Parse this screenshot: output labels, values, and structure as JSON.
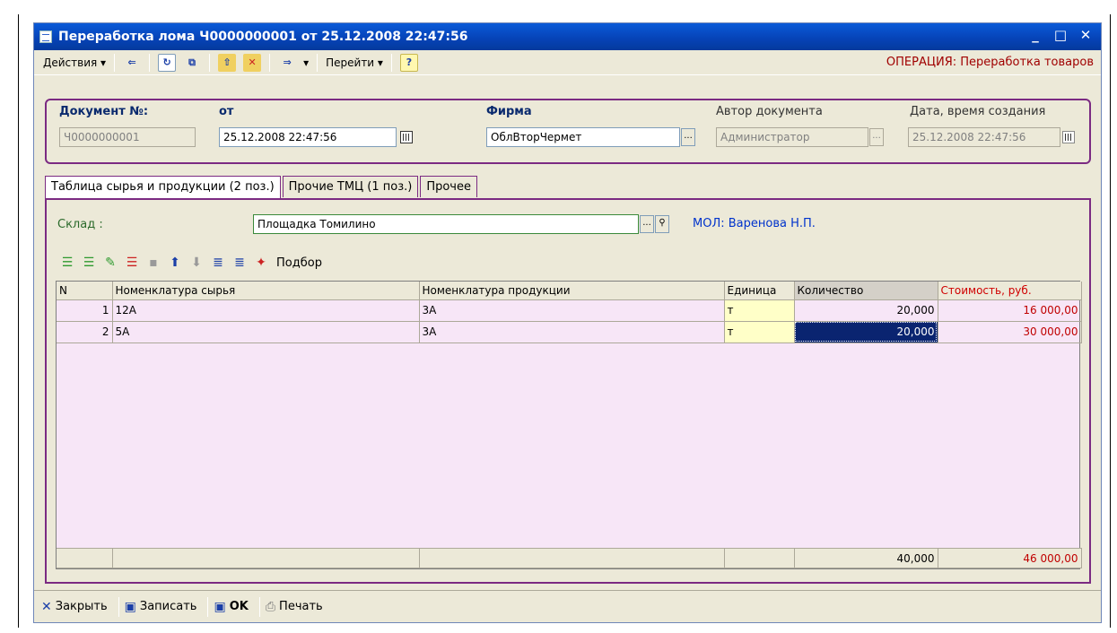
{
  "window": {
    "title": "Переработка лома Ч0000000001 от 25.12.2008 22:47:56",
    "controls": {
      "minimize": "_",
      "maximize": "□",
      "close": "✕"
    }
  },
  "toolbar": {
    "actions_label": "Действия ▾",
    "goto_label": "Перейти ▾",
    "help_label": "?",
    "operation_text": "ОПЕРАЦИЯ: Переработка товаров"
  },
  "header": {
    "doc_number_label": "Документ №:",
    "doc_number_value": "Ч0000000001",
    "date_label": "от",
    "date_value": "25.12.2008 22:47:56",
    "firm_label": "Фирма",
    "firm_value": "ОблВторЧермет",
    "author_label": "Автор документа",
    "author_value": "Администратор",
    "created_label": "Дата, время создания",
    "created_value": "25.12.2008 22:47:56"
  },
  "tabs": [
    {
      "label": "Таблица сырья и продукции (2 поз.)"
    },
    {
      "label": "Прочие ТМЦ (1 поз.)"
    },
    {
      "label": "Прочее"
    }
  ],
  "warehouse": {
    "label": "Склад :",
    "value": "Площадка Томилино",
    "mol_text": "МОЛ: Варенова Н.П."
  },
  "grid_toolbar": {
    "podbor_label": "Подбор"
  },
  "grid": {
    "columns": [
      "N",
      "Номенклатура сырья",
      "Номенклатура продукции",
      "Единица",
      "Количество",
      "Стоимость, руб."
    ],
    "rows": [
      {
        "n": "1",
        "raw": "12А",
        "product": "3А",
        "unit": "т",
        "qty": "20,000",
        "cost": "16 000,00"
      },
      {
        "n": "2",
        "raw": "5А",
        "product": "3А",
        "unit": "т",
        "qty": "20,000",
        "cost": "30 000,00"
      }
    ],
    "totals": {
      "qty": "40,000",
      "cost": "46 000,00"
    }
  },
  "bottom_bar": {
    "close_label": "Закрыть",
    "save_label": "Записать",
    "ok_label": "OK",
    "print_label": "Печать"
  },
  "colors": {
    "title_blue": "#0642B5",
    "frame_purple": "#7B2A82",
    "operation_red": "#A00000",
    "grid_pink": "#F7E6F7",
    "unit_yellow": "#FFFFC8"
  }
}
